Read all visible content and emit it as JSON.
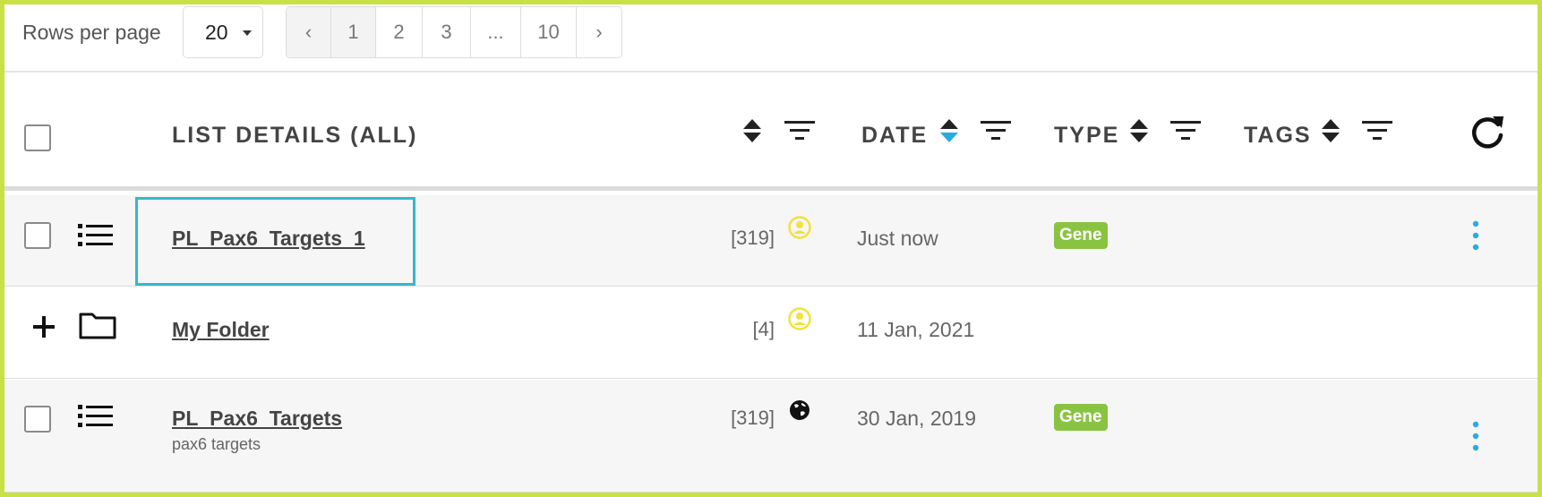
{
  "pagination": {
    "rows_per_page_label": "Rows per page",
    "rows_per_page_value": "20",
    "prev": "‹",
    "pages": [
      "1",
      "2",
      "3",
      "...",
      "10"
    ],
    "active_page": "1",
    "next": "›"
  },
  "header": {
    "list_details": "LIST DETAILS (ALL)",
    "date": "DATE",
    "type": "TYPE",
    "tags": "TAGS",
    "sort_active_column": "date",
    "sort_active_color": "#29abe2"
  },
  "rows": [
    {
      "kind": "list",
      "name": "PL_Pax6_Targets_1",
      "subtitle": "",
      "count": "[319]",
      "owner_icon": "user-icon",
      "owner_icon_color": "#f2e23a",
      "date": "Just now",
      "type": "Gene",
      "focused": true
    },
    {
      "kind": "folder",
      "name": "My Folder",
      "subtitle": "",
      "count": "[4]",
      "owner_icon": "user-icon",
      "owner_icon_color": "#f2e23a",
      "date": "11 Jan, 2021",
      "type": "",
      "focused": false
    },
    {
      "kind": "list",
      "name": "PL_Pax6_Targets",
      "subtitle": "pax6 targets",
      "count": "[319]",
      "owner_icon": "globe-icon",
      "owner_icon_color": "#111111",
      "date": "30 Jan, 2019",
      "type": "Gene",
      "focused": false
    }
  ],
  "colors": {
    "frame_border": "#c9e145",
    "badge_gene": "#8ac342",
    "menu_dots": "#29abe2",
    "focus_outline": "#35b8cc"
  }
}
